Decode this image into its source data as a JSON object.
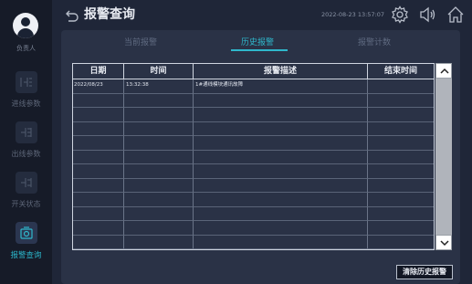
{
  "sidebar": {
    "user_label": "负责人",
    "items": [
      {
        "label": "进线参数",
        "icon": "inlet-params-icon"
      },
      {
        "label": "出线参数",
        "icon": "outlet-params-icon"
      },
      {
        "label": "开关状态",
        "icon": "switch-status-icon"
      },
      {
        "label": "报警查询",
        "icon": "alarm-query-icon",
        "active": true
      }
    ]
  },
  "header": {
    "title": "报警查询",
    "datetime": "2022-08-23 13:57:07"
  },
  "tabs": [
    {
      "label": "当前报警",
      "active": false
    },
    {
      "label": "历史报警",
      "active": true
    },
    {
      "label": "报警计数",
      "active": false
    }
  ],
  "table": {
    "columns": [
      "日期",
      "时间",
      "报警描述",
      "结束时间"
    ],
    "rows": [
      {
        "date": "2022/08/23",
        "time": "13:32:38",
        "description": "1#通线模块通讯故障",
        "end_time": ""
      }
    ]
  },
  "actions": {
    "clear_label": "清除历史报警"
  },
  "colors": {
    "accent": "#2fb7cb",
    "background": "#1f2638",
    "sidebar": "#161b28",
    "panel": "#2a3246"
  }
}
